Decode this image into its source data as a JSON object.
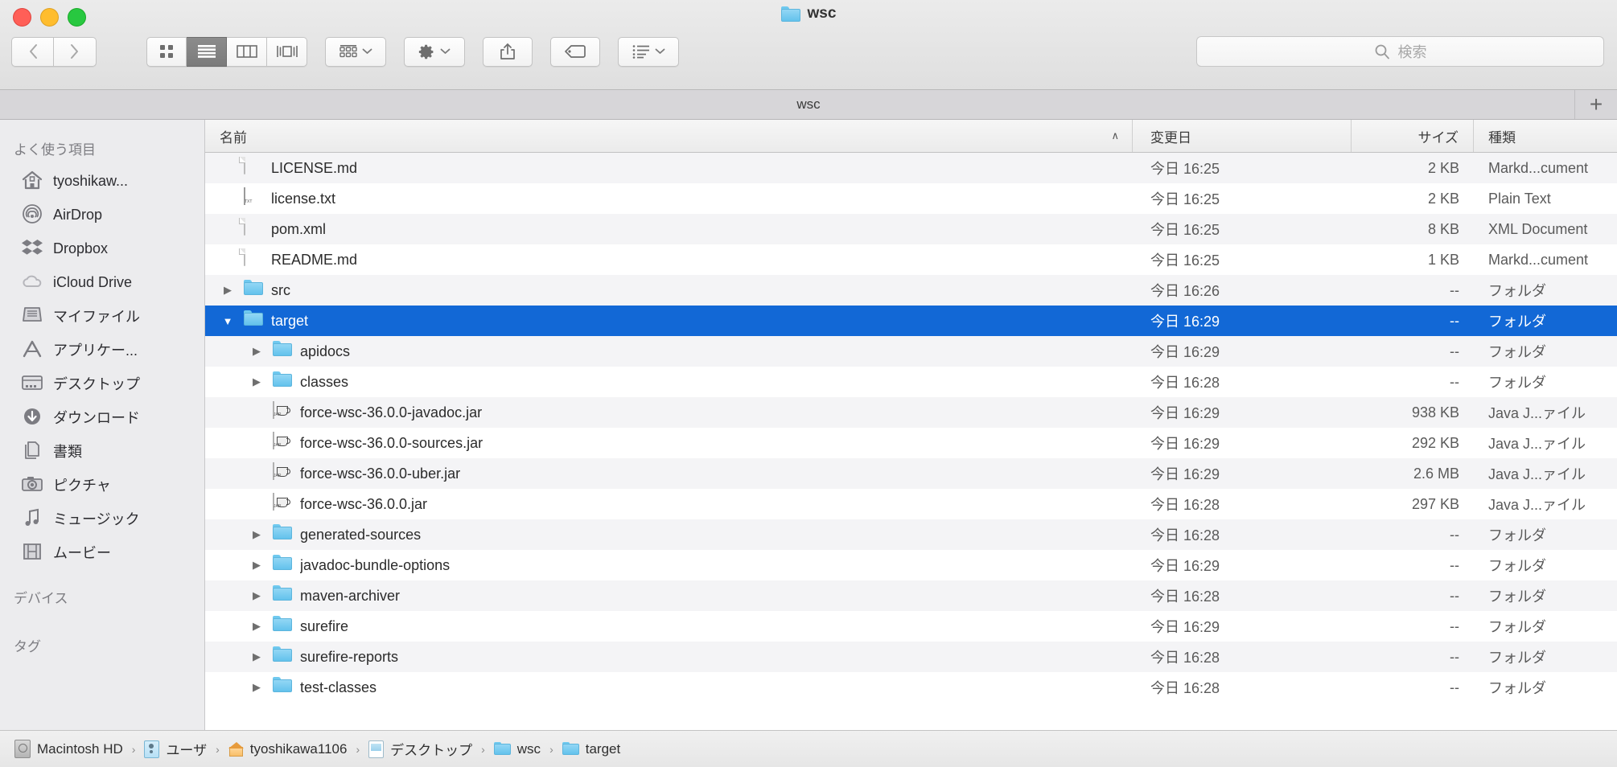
{
  "window": {
    "title": "wsc",
    "traffic_lights": [
      "close",
      "minimize",
      "zoom"
    ]
  },
  "toolbar": {
    "back_label": "‹",
    "forward_label": "›",
    "view_modes": [
      {
        "name": "icon-view",
        "active": false
      },
      {
        "name": "list-view",
        "active": true
      },
      {
        "name": "column-view",
        "active": false
      },
      {
        "name": "coverflow-view",
        "active": false
      }
    ],
    "arrange_label": "arrange-icon",
    "action_label": "gear-icon",
    "share_label": "share-icon",
    "tag_label": "tag-icon",
    "list_options_label": "list-options-icon",
    "dropdown_glyph": "⌄"
  },
  "search": {
    "placeholder": "検索",
    "value": "",
    "icon": "search-icon"
  },
  "tabbar": {
    "active_tab": "wsc",
    "new_tab_glyph": "+"
  },
  "sidebar": {
    "sections": [
      {
        "header": "よく使う項目",
        "items": [
          {
            "label": "tyoshikaw...",
            "icon": "home-icon"
          },
          {
            "label": "AirDrop",
            "icon": "airdrop-icon"
          },
          {
            "label": "Dropbox",
            "icon": "dropbox-icon"
          },
          {
            "label": "iCloud Drive",
            "icon": "cloud-icon"
          },
          {
            "label": "マイファイル",
            "icon": "allmyfiles-icon"
          },
          {
            "label": "アプリケー...",
            "icon": "applications-icon"
          },
          {
            "label": "デスクトップ",
            "icon": "desktop-icon"
          },
          {
            "label": "ダウンロード",
            "icon": "downloads-icon"
          },
          {
            "label": "書類",
            "icon": "documents-icon"
          },
          {
            "label": "ピクチャ",
            "icon": "pictures-icon"
          },
          {
            "label": "ミュージック",
            "icon": "music-icon"
          },
          {
            "label": "ムービー",
            "icon": "movies-icon"
          }
        ]
      },
      {
        "header": "デバイス",
        "items": []
      },
      {
        "header": "タグ",
        "items": []
      }
    ]
  },
  "filelist": {
    "columns": {
      "name": "名前",
      "date_modified": "変更日",
      "size": "サイズ",
      "kind": "種類"
    },
    "sort": {
      "column": "name",
      "direction": "ascending",
      "glyph": "∧"
    },
    "rows": [
      {
        "name": "LICENSE.md",
        "date": "今日 16:25",
        "size": "2 KB",
        "kind": "Markd...cument",
        "icon": "document-icon",
        "indent": 0,
        "disclosure": "none",
        "selected": false
      },
      {
        "name": "license.txt",
        "date": "今日 16:25",
        "size": "2 KB",
        "kind": "Plain Text",
        "icon": "text-file-icon",
        "indent": 0,
        "disclosure": "none",
        "selected": false
      },
      {
        "name": "pom.xml",
        "date": "今日 16:25",
        "size": "8 KB",
        "kind": "XML Document",
        "icon": "document-icon",
        "indent": 0,
        "disclosure": "none",
        "selected": false
      },
      {
        "name": "README.md",
        "date": "今日 16:25",
        "size": "1 KB",
        "kind": "Markd...cument",
        "icon": "document-icon",
        "indent": 0,
        "disclosure": "none",
        "selected": false
      },
      {
        "name": "src",
        "date": "今日 16:26",
        "size": "--",
        "kind": "フォルダ",
        "icon": "folder-icon",
        "indent": 0,
        "disclosure": "collapsed",
        "selected": false
      },
      {
        "name": "target",
        "date": "今日 16:29",
        "size": "--",
        "kind": "フォルダ",
        "icon": "folder-icon",
        "indent": 0,
        "disclosure": "expanded",
        "selected": true
      },
      {
        "name": "apidocs",
        "date": "今日 16:29",
        "size": "--",
        "kind": "フォルダ",
        "icon": "folder-icon",
        "indent": 1,
        "disclosure": "collapsed",
        "selected": false
      },
      {
        "name": "classes",
        "date": "今日 16:28",
        "size": "--",
        "kind": "フォルダ",
        "icon": "folder-icon",
        "indent": 1,
        "disclosure": "collapsed",
        "selected": false
      },
      {
        "name": "force-wsc-36.0.0-javadoc.jar",
        "date": "今日 16:29",
        "size": "938 KB",
        "kind": "Java J...ァイル",
        "icon": "jar-icon",
        "indent": 1,
        "disclosure": "none",
        "selected": false
      },
      {
        "name": "force-wsc-36.0.0-sources.jar",
        "date": "今日 16:29",
        "size": "292 KB",
        "kind": "Java J...ァイル",
        "icon": "jar-icon",
        "indent": 1,
        "disclosure": "none",
        "selected": false
      },
      {
        "name": "force-wsc-36.0.0-uber.jar",
        "date": "今日 16:29",
        "size": "2.6 MB",
        "kind": "Java J...ァイル",
        "icon": "jar-icon",
        "indent": 1,
        "disclosure": "none",
        "selected": false
      },
      {
        "name": "force-wsc-36.0.0.jar",
        "date": "今日 16:28",
        "size": "297 KB",
        "kind": "Java J...ァイル",
        "icon": "jar-icon",
        "indent": 1,
        "disclosure": "none",
        "selected": false
      },
      {
        "name": "generated-sources",
        "date": "今日 16:28",
        "size": "--",
        "kind": "フォルダ",
        "icon": "folder-icon",
        "indent": 1,
        "disclosure": "collapsed",
        "selected": false
      },
      {
        "name": "javadoc-bundle-options",
        "date": "今日 16:29",
        "size": "--",
        "kind": "フォルダ",
        "icon": "folder-icon",
        "indent": 1,
        "disclosure": "collapsed",
        "selected": false
      },
      {
        "name": "maven-archiver",
        "date": "今日 16:28",
        "size": "--",
        "kind": "フォルダ",
        "icon": "folder-icon",
        "indent": 1,
        "disclosure": "collapsed",
        "selected": false
      },
      {
        "name": "surefire",
        "date": "今日 16:29",
        "size": "--",
        "kind": "フォルダ",
        "icon": "folder-icon",
        "indent": 1,
        "disclosure": "collapsed",
        "selected": false
      },
      {
        "name": "surefire-reports",
        "date": "今日 16:28",
        "size": "--",
        "kind": "フォルダ",
        "icon": "folder-icon",
        "indent": 1,
        "disclosure": "collapsed",
        "selected": false
      },
      {
        "name": "test-classes",
        "date": "今日 16:28",
        "size": "--",
        "kind": "フォルダ",
        "icon": "folder-icon",
        "indent": 1,
        "disclosure": "collapsed",
        "selected": false
      }
    ]
  },
  "pathbar": {
    "separator": "›",
    "items": [
      {
        "label": "Macintosh HD",
        "icon": "harddisk-icon"
      },
      {
        "label": "ユーザ",
        "icon": "users-icon"
      },
      {
        "label": "tyoshikawa1106",
        "icon": "home-icon"
      },
      {
        "label": "デスクトップ",
        "icon": "desktop-icon"
      },
      {
        "label": "wsc",
        "icon": "folder-icon"
      },
      {
        "label": "target",
        "icon": "folder-icon"
      }
    ]
  },
  "colors": {
    "selection_blue": "#1268d6",
    "folder_blue": "#7fcdef",
    "sidebar_bg": "#ececee"
  }
}
